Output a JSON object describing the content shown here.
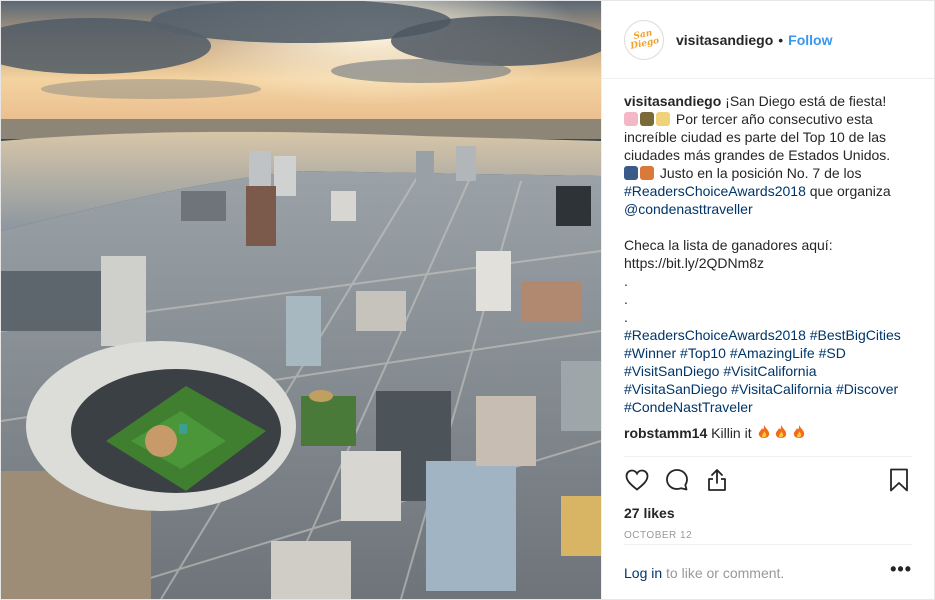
{
  "post": {
    "image_alt": "Aerial view of downtown San Diego with baseball stadium at sunset",
    "header": {
      "avatar_logo_text": "San Diego",
      "username": "visitasandiego",
      "separator": "•",
      "follow_label": "Follow"
    },
    "caption": {
      "username": "visitasandiego",
      "line1": "¡San Diego está de fiesta!",
      "line2": "Por tercer año consecutivo esta",
      "line3": "increíble ciudad es parte del Top 10 de las",
      "line4": "ciudades más grandes de Estados Unidos.",
      "line5": "Justo en la posición No. 7 de los",
      "hashtag_readers": "#ReadersChoiceAwards2018",
      "line6_rest": " que organiza",
      "mention": "@condenasttraveller",
      "line_checa": "Checa la lista de ganadores aquí:",
      "url": "https://bit.ly/2QDNm8z",
      "dot1": ".",
      "dot2": ".",
      "dot3": ".",
      "tag1": "#ReadersChoiceAwards2018",
      "tag2": "#BestBigCities",
      "tag3": "#Winner",
      "tag4": "#Top10",
      "tag5": "#AmazingLife",
      "tag6": "#SD",
      "tag7": "#VisitSanDiego",
      "tag8": "#VisitCalifornia",
      "tag9": "#VisitaSanDiego",
      "tag10": "#VisitaCalifornia",
      "tag11": "#Discover",
      "tag12": "#CondeNastTraveler"
    },
    "comment": {
      "username": "robstamm14",
      "text": "Killin it"
    },
    "actions": {
      "like_icon": "heart-icon",
      "comment_icon": "comment-bubble-icon",
      "share_icon": "share-icon",
      "save_icon": "bookmark-icon"
    },
    "likes": "27 likes",
    "date": "OCTOBER 12",
    "footer": {
      "login_label": "Log in",
      "login_suffix": " to like or comment.",
      "more_label": "•••"
    },
    "colors": {
      "link": "#003569",
      "follow": "#3897f0",
      "muted": "#999999",
      "text": "#262626"
    }
  }
}
